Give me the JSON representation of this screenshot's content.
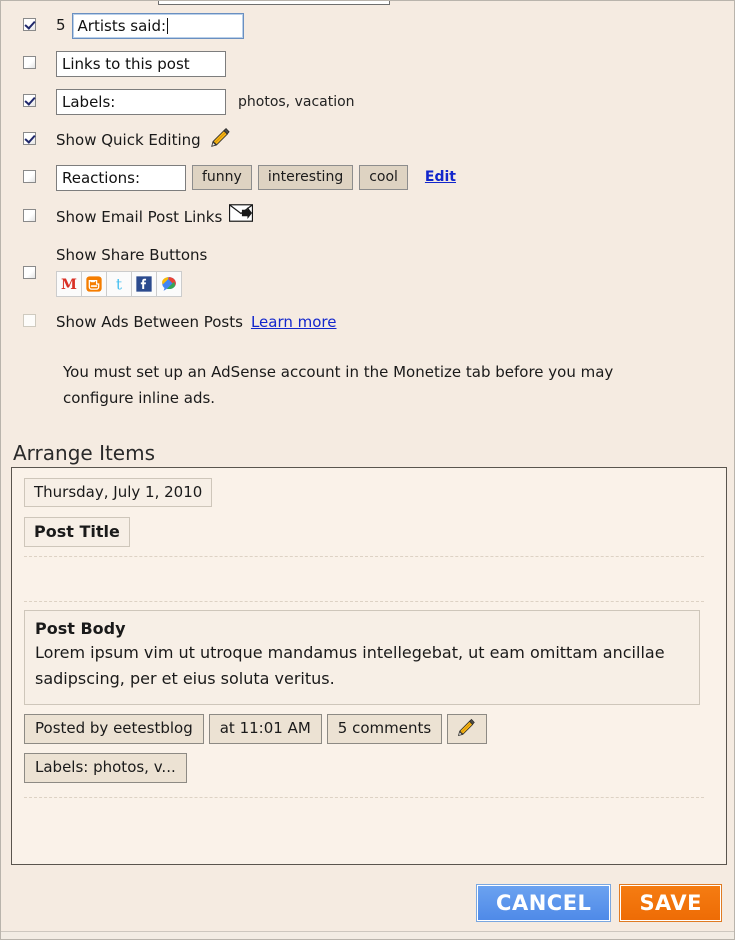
{
  "options": [
    {
      "name": "comments",
      "checked": true,
      "count": "5",
      "input_value": "Artists said:",
      "input_width": 172,
      "focused": true
    },
    {
      "name": "backlinks",
      "checked": false,
      "input_value": "Links to this post",
      "input_width": 170,
      "focused": false
    },
    {
      "name": "labels",
      "checked": true,
      "input_value": "Labels:",
      "input_width": 170,
      "focused": false,
      "side_text": "photos, vacation"
    },
    {
      "name": "quick-editing",
      "checked": true,
      "label": "Show Quick Editing",
      "icon": "pencil-icon"
    },
    {
      "name": "reactions",
      "checked": false,
      "input_value": "Reactions:",
      "input_width": 130,
      "focused": false,
      "chips": [
        "funny",
        "interesting",
        "cool"
      ],
      "edit_label": "Edit"
    },
    {
      "name": "email-post-links",
      "checked": false,
      "label": "Show Email Post Links",
      "icon": "envelope-forward-icon"
    },
    {
      "name": "share-buttons",
      "checked": false,
      "label": "Show Share Buttons",
      "share_icons": [
        "gmail-icon",
        "blogger-icon",
        "twitter-icon",
        "facebook-icon",
        "buzz-icon"
      ]
    },
    {
      "name": "ads-between-posts",
      "checked": false,
      "disabled": true,
      "label": "Show Ads Between Posts",
      "learn_more_label": "Learn more"
    }
  ],
  "ads_note": "You must set up an AdSense account in the Monetize tab before you may configure inline ads.",
  "arrange": {
    "title": "Arrange Items",
    "date_block": "Thursday, July 1, 2010",
    "title_block": "Post Title",
    "body_heading": "Post Body",
    "body_text": "Lorem ipsum vim ut utroque mandamus intellegebat, ut eam omittam ancillae sadipscing, per et eius soluta veritus.",
    "meta_buttons": [
      "Posted by eetestblog",
      "at 11:01 AM",
      "5 comments"
    ],
    "meta_edit_icon": "pencil-icon",
    "labels_button": "Labels: photos, v..."
  },
  "footer": {
    "cancel_label": "CANCEL",
    "save_label": "SAVE"
  },
  "colors": {
    "page_background": "#f5ebe1",
    "panel_background": "#faf2e9",
    "link": "#1226cc",
    "cancel_button": "#4f8ae8",
    "save_button": "#ee6c05",
    "checkbox_check": "#20286b"
  }
}
